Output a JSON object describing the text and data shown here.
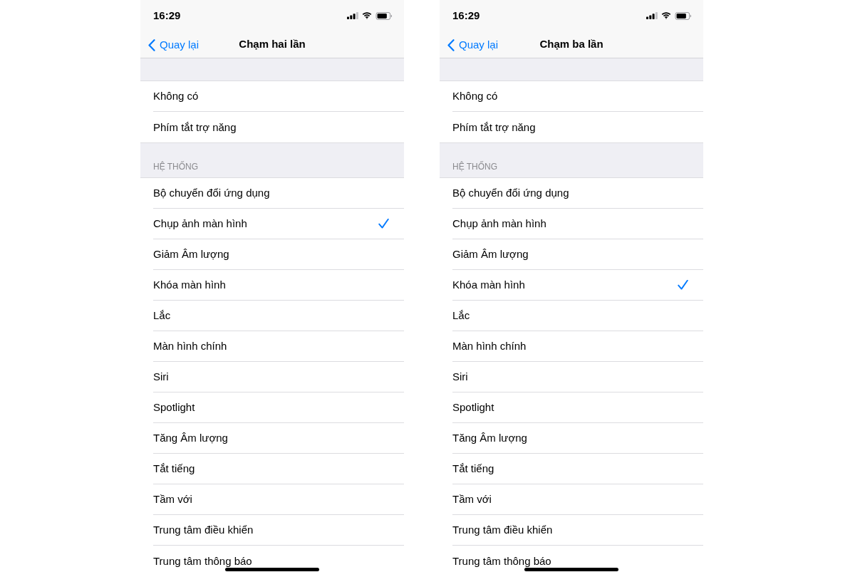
{
  "screens": [
    {
      "status_bar": {
        "time": "16:29"
      },
      "nav_bar": {
        "back": "Quay lại",
        "title": "Chạm hai lần"
      },
      "groups": [
        {
          "items": [
            {
              "label": "Không có",
              "selected": false
            },
            {
              "label": "Phím tắt trợ năng",
              "selected": false
            }
          ]
        },
        {
          "header": "HỆ THỐNG",
          "items": [
            {
              "label": "Bộ chuyển đổi ứng dụng",
              "selected": false
            },
            {
              "label": "Chụp ảnh màn hình",
              "selected": true
            },
            {
              "label": "Giảm Âm lượng",
              "selected": false
            },
            {
              "label": "Khóa màn hình",
              "selected": false
            },
            {
              "label": "Lắc",
              "selected": false
            },
            {
              "label": "Màn hình chính",
              "selected": false
            },
            {
              "label": "Siri",
              "selected": false
            },
            {
              "label": "Spotlight",
              "selected": false
            },
            {
              "label": "Tăng Âm lượng",
              "selected": false
            },
            {
              "label": "Tắt tiếng",
              "selected": false
            },
            {
              "label": "Tầm với",
              "selected": false
            },
            {
              "label": "Trung tâm điều khiển",
              "selected": false
            },
            {
              "label": "Trung tâm thông báo",
              "selected": false
            }
          ]
        }
      ]
    },
    {
      "status_bar": {
        "time": "16:29"
      },
      "nav_bar": {
        "back": "Quay lại",
        "title": "Chạm ba lần"
      },
      "groups": [
        {
          "items": [
            {
              "label": "Không có",
              "selected": false
            },
            {
              "label": "Phím tắt trợ năng",
              "selected": false
            }
          ]
        },
        {
          "header": "HỆ THỐNG",
          "items": [
            {
              "label": "Bộ chuyển đổi ứng dụng",
              "selected": false
            },
            {
              "label": "Chụp ảnh màn hình",
              "selected": false
            },
            {
              "label": "Giảm Âm lượng",
              "selected": false
            },
            {
              "label": "Khóa màn hình",
              "selected": true
            },
            {
              "label": "Lắc",
              "selected": false
            },
            {
              "label": "Màn hình chính",
              "selected": false
            },
            {
              "label": "Siri",
              "selected": false
            },
            {
              "label": "Spotlight",
              "selected": false
            },
            {
              "label": "Tăng Âm lượng",
              "selected": false
            },
            {
              "label": "Tắt tiếng",
              "selected": false
            },
            {
              "label": "Tầm với",
              "selected": false
            },
            {
              "label": "Trung tâm điều khiển",
              "selected": false
            },
            {
              "label": "Trung tâm thông báo",
              "selected": false
            }
          ]
        }
      ]
    }
  ]
}
